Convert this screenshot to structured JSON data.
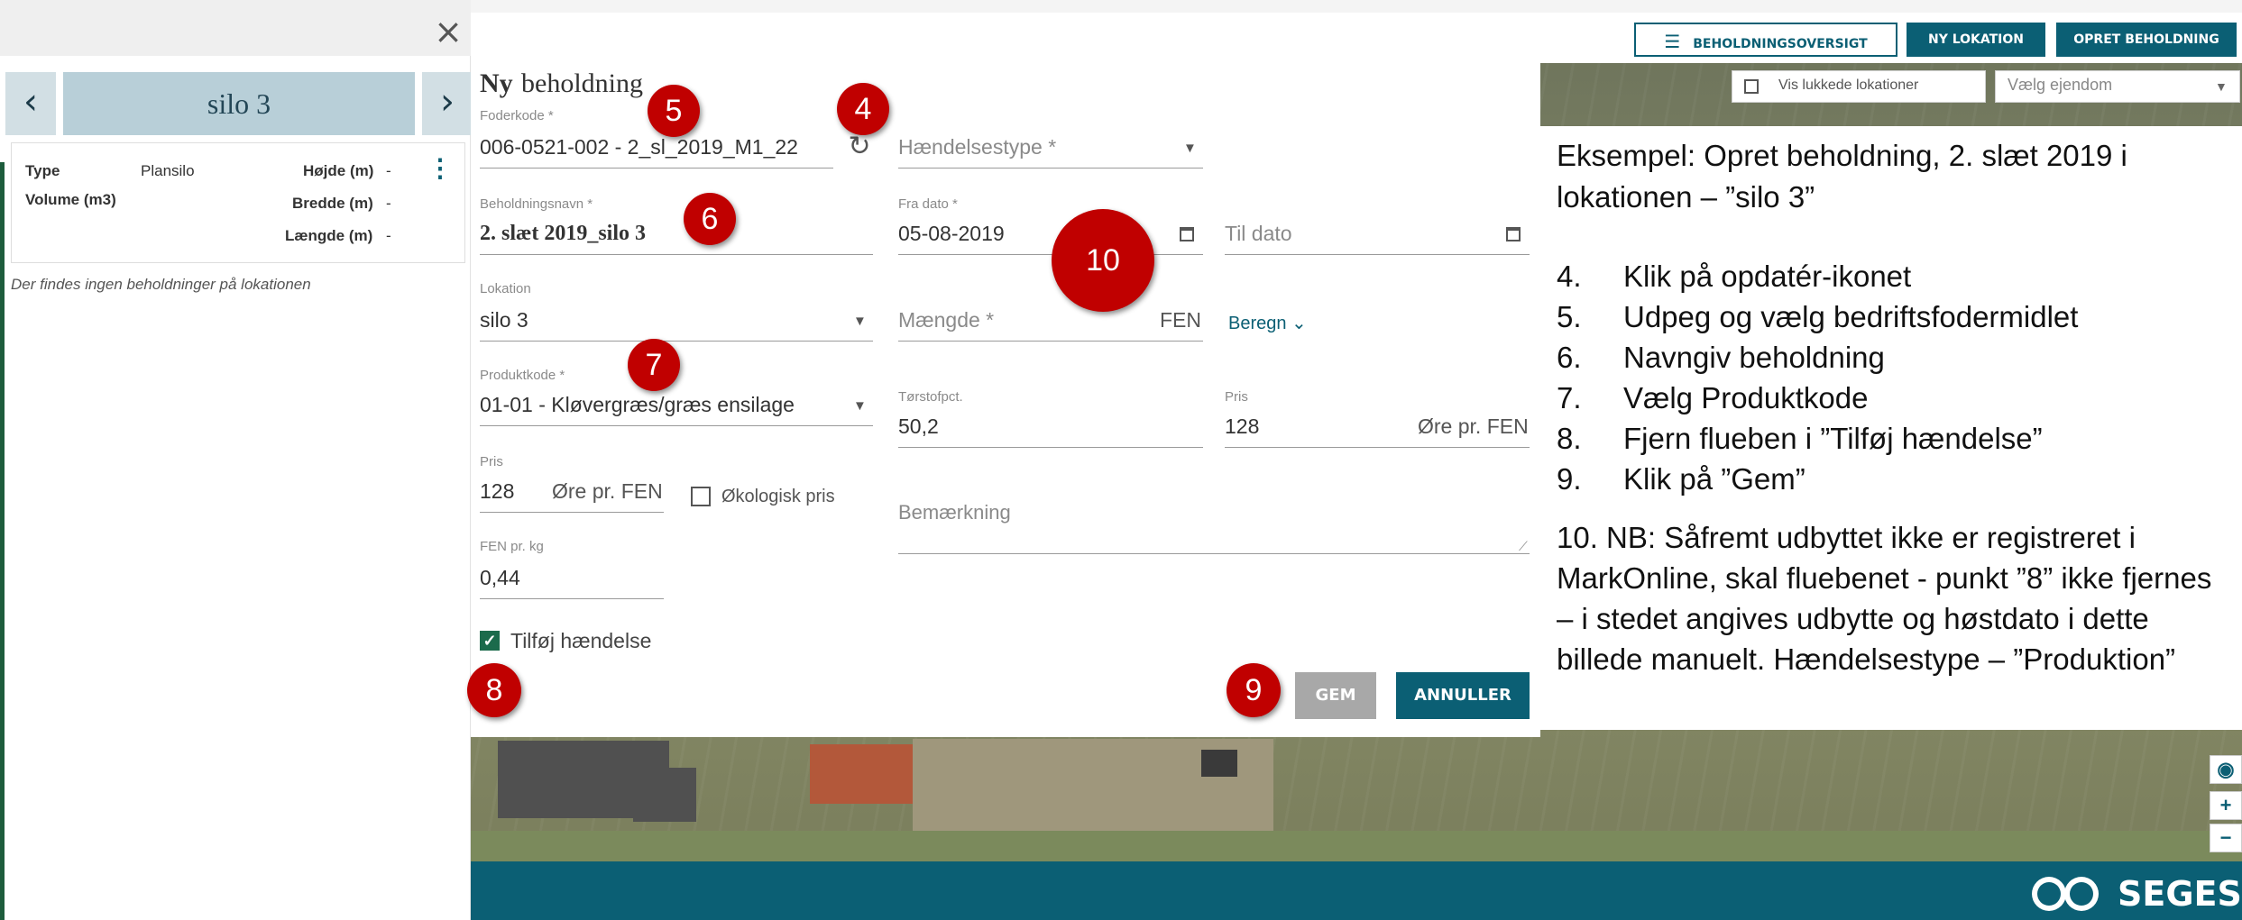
{
  "left_panel": {
    "close_glyph": "×",
    "prev_glyph": "‹",
    "next_glyph": "›",
    "silo_title": "silo 3",
    "info": {
      "type_label": "Type",
      "type_value": "Plansilo",
      "volume_label": "Volume (m3)",
      "hoejde_label": "Højde (m)",
      "hoejde_value": "-",
      "bredde_label": "Bredde (m)",
      "bredde_value": "-",
      "laengde_label": "Længde (m)",
      "laengde_value": "-",
      "kebab_glyph": "⋮"
    },
    "no_holdings_text": "Der findes ingen beholdninger på lokationen"
  },
  "toolbar": {
    "oversigt_icon": "☰",
    "oversigt_label": "BEHOLDNINGSOVERSIGT",
    "ny_lokation_label": "NY LOKATION",
    "opret_label": "OPRET BEHOLDNING",
    "vis_lukkede_label": "Vis lukkede lokationer",
    "ejendom_placeholder": "Vælg ejendom"
  },
  "form": {
    "title_bold": "Ny",
    "title_rest": "beholdning",
    "foderkode_label": "Foderkode *",
    "foderkode_value": "006-0521-002 - 2_sl_2019_M1_22",
    "haendelsestype_placeholder": "Hændelsestype *",
    "beholdningsnavn_label": "Beholdningsnavn *",
    "beholdningsnavn_value": "2. slæt 2019_silo 3",
    "fra_dato_label": "Fra dato *",
    "fra_dato_value": "05-08-2019",
    "til_dato_placeholder": "Til dato",
    "lokation_label": "Lokation",
    "lokation_value": "silo 3",
    "maengde_placeholder": "Mængde *",
    "maengde_unit": "FEN",
    "beregn_label": "Beregn ⌄",
    "produktkode_label": "Produktkode *",
    "produktkode_value": "01-01 - Kløvergræs/græs ensilage",
    "toerstof_label": "Tørstofpct.",
    "toerstof_value": "50,2",
    "pris_right_label": "Pris",
    "pris_right_value": "128",
    "pris_right_unit": "Øre pr. FEN",
    "pris_left_label": "Pris",
    "pris_left_value": "128",
    "pris_left_unit": "Øre pr. FEN",
    "oekologisk_label": "Økologisk pris",
    "bemaerkning_placeholder": "Bemærkning",
    "fen_pr_kg_label": "FEN pr. kg",
    "fen_pr_kg_value": "0,44",
    "tilfoej_label": "Tilføj hændelse",
    "tilfoej_checked": true,
    "gem_label": "GEM",
    "annuller_label": "ANNULLER",
    "refresh_glyph": "↻",
    "caret_glyph": "▼"
  },
  "callouts": {
    "c4": "4",
    "c5": "5",
    "c6": "6",
    "c7": "7",
    "c8": "8",
    "c9": "9",
    "c10": "10"
  },
  "instructions": {
    "intro": "Eksempel: Opret beholdning, 2. slæt 2019 i lokationen – ”silo 3”",
    "steps": [
      {
        "num": "4.",
        "text": "Klik på opdatér-ikonet"
      },
      {
        "num": "5.",
        "text": "Udpeg og vælg bedriftsfodermidlet"
      },
      {
        "num": "6.",
        "text": "Navngiv beholdning"
      },
      {
        "num": "7.",
        "text": "Vælg Produktkode"
      },
      {
        "num": "8.",
        "text": "Fjern flueben i ”Tilføj hændelse”"
      },
      {
        "num": "9.",
        "text": "Klik på ”Gem”"
      }
    ],
    "note": "10. NB: Såfremt udbyttet ikke er registreret i MarkOnline, skal fluebenet  - punkt ”8” ikke fjernes – i stedet angives udbytte og høstdato i dette billede manuelt. Hændelsestype – ”Produktion”"
  },
  "map_controls": {
    "eye_glyph": "◉",
    "zoom_in": "+",
    "zoom_out": "−"
  },
  "footer": {
    "logo_text": "SEGES"
  },
  "colors": {
    "accent": "#0b5f74",
    "callout_red": "#c00000",
    "checkbox_green": "#1b6b4c"
  }
}
